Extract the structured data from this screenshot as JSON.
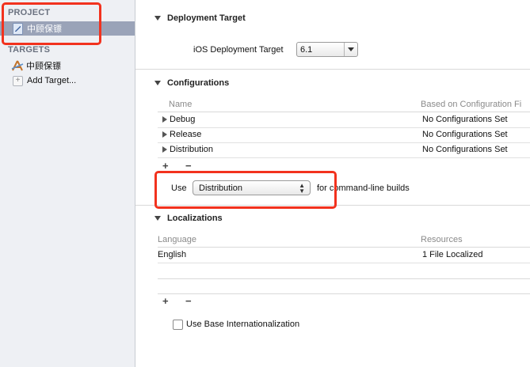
{
  "sidebar": {
    "project_header": "PROJECT",
    "project_item": "中顾保镖",
    "targets_header": "TARGETS",
    "target_item": "中顾保镖",
    "add_target": "Add Target..."
  },
  "deployment": {
    "title": "Deployment Target",
    "label": "iOS Deployment Target",
    "value": "6.1"
  },
  "configurations": {
    "title": "Configurations",
    "columns": [
      "Name",
      "Based on Configuration Fi"
    ],
    "rows": [
      {
        "name": "Debug",
        "based_on": "No Configurations Set"
      },
      {
        "name": "Release",
        "based_on": "No Configurations Set"
      },
      {
        "name": "Distribution",
        "based_on": "No Configurations Set"
      }
    ],
    "add": "+",
    "remove": "−",
    "use_label": "Use",
    "use_value": "Distribution",
    "use_suffix": "for command-line builds"
  },
  "localizations": {
    "title": "Localizations",
    "columns": [
      "Language",
      "Resources"
    ],
    "rows": [
      {
        "language": "English",
        "resources": "1 File Localized"
      }
    ],
    "add": "+",
    "remove": "−",
    "checkbox_label": "Use Base Internationalization"
  },
  "colors": {
    "highlight": "#f2321e",
    "selection": "#9aa3b8"
  }
}
